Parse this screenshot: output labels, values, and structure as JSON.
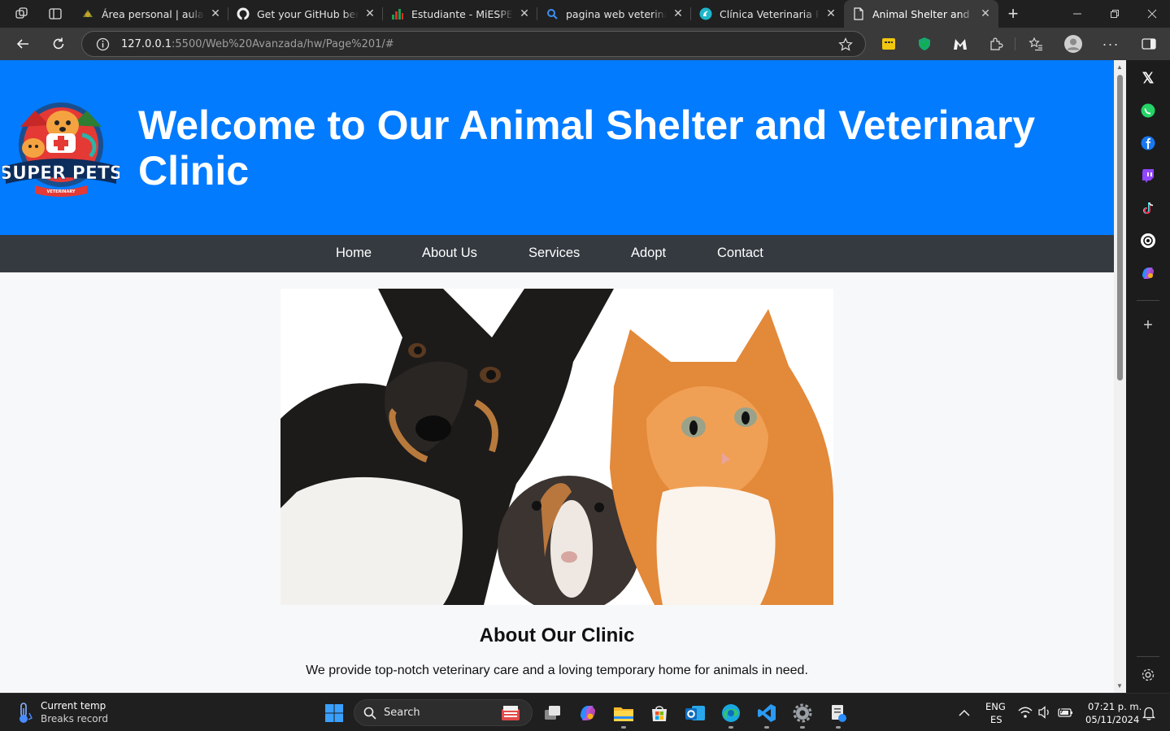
{
  "browser": {
    "tabs": [
      {
        "title": "Área personal | aula",
        "favicon": "moodle-favicon"
      },
      {
        "title": "Get your GitHub benefits",
        "favicon": "github-favicon"
      },
      {
        "title": "Estudiante - MiESPE",
        "favicon": "espe-favicon"
      },
      {
        "title": "pagina web veterinaria - Buscar",
        "favicon": "search-favicon"
      },
      {
        "title": "Clínica Veterinaria Pancho",
        "favicon": "clinic-favicon"
      },
      {
        "title": "Animal Shelter and Veterinary Clinic",
        "favicon": "page-favicon"
      }
    ],
    "url_host": "127.0.0.1",
    "url_path": ":5500/Web%20Avanzada/hw/Page%201/#"
  },
  "site": {
    "title": "Welcome to Our Animal Shelter and Veterinary Clinic",
    "logo_text": "SUPER PETS",
    "logo_subtext": "VETERINARY",
    "nav": [
      "Home",
      "About Us",
      "Services",
      "Adopt",
      "Contact"
    ],
    "about_title": "About Our Clinic",
    "about_text": "We provide top-notch veterinary care and a loving temporary home for animals in need."
  },
  "taskbar": {
    "weather_title": "Current temp",
    "weather_sub": "Breaks record",
    "search_placeholder": "Search",
    "lang_top": "ENG",
    "lang_bottom": "ES",
    "time": "07:21 p. m.",
    "date": "05/11/2024"
  },
  "colors": {
    "header_bg": "#027bff",
    "nav_bg": "#343a40",
    "page_bg": "#f7f8fa"
  }
}
